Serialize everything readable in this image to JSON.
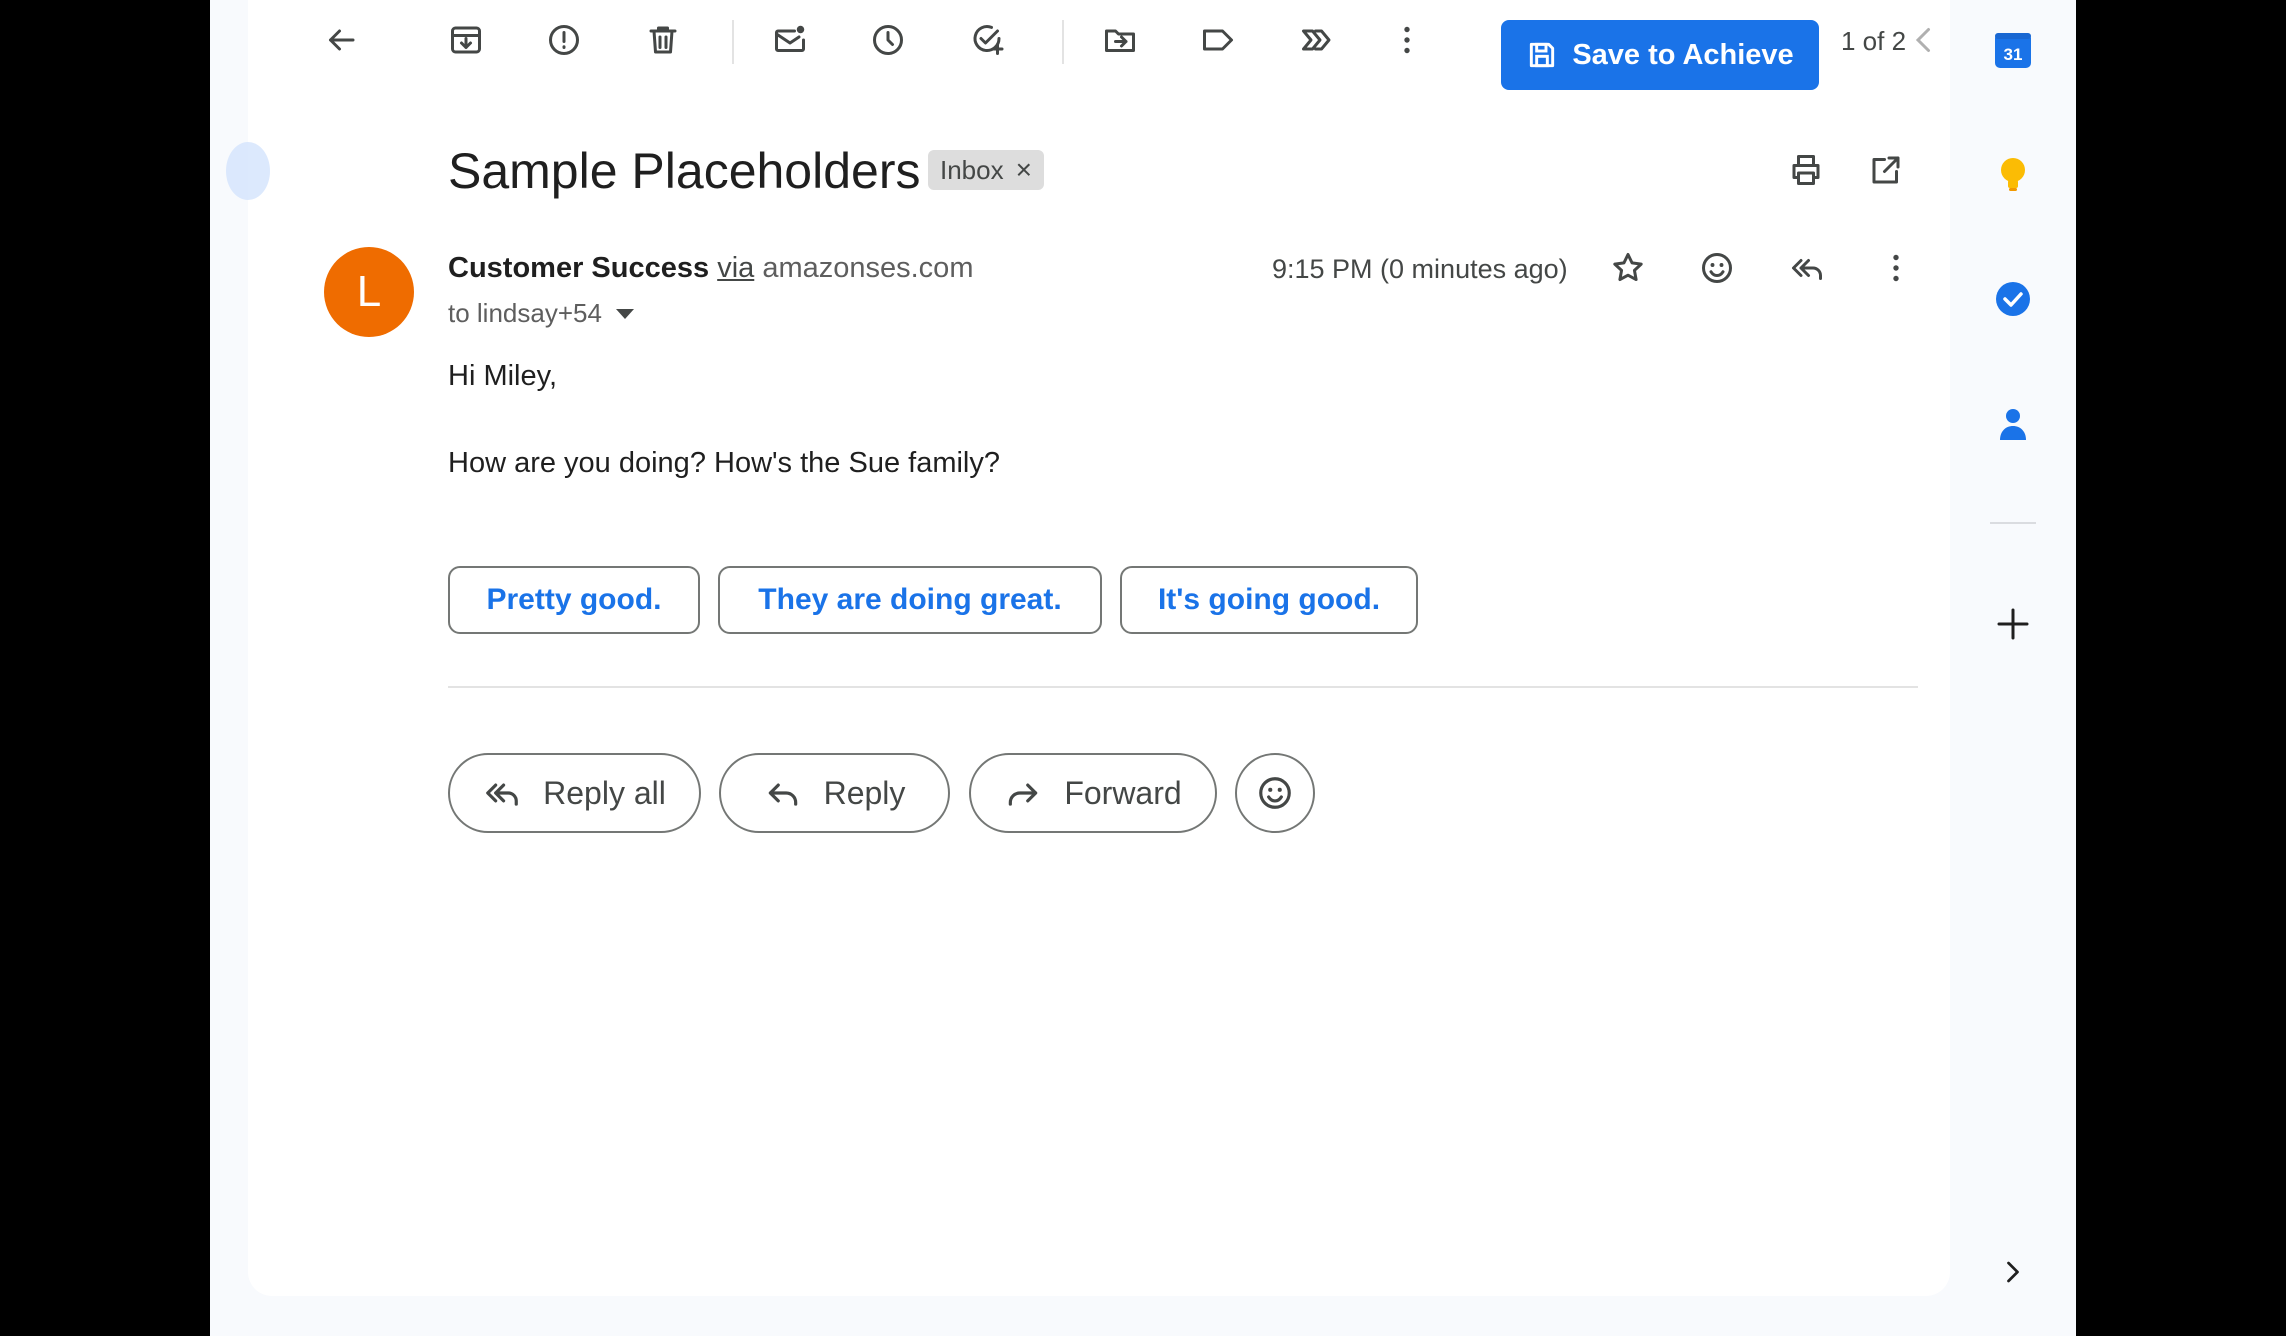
{
  "toolbar": {
    "icons": [
      "arrow-left-icon",
      "archive-icon",
      "report-spam-icon",
      "trash-icon",
      "mark-unread-icon",
      "snooze-icon",
      "add-task-icon",
      "move-to-icon",
      "label-icon",
      "filter-icon",
      "more-vert-icon"
    ],
    "save_button_label": "Save to Achieve",
    "pager": "1 of 2"
  },
  "email": {
    "subject": "Sample Placeholders",
    "label_chip": "Inbox",
    "label_remove": "×",
    "avatar_letter": "L",
    "avatar_color": "#ef6c00",
    "sender_name": "Customer Success",
    "via_text": "via",
    "sender_domain": "amazonses.com",
    "to_text": "to lindsay+54",
    "timestamp": "9:15 PM (0 minutes ago)",
    "body": {
      "greeting": "Hi Miley,",
      "line1": "How are you doing? How's the Sue family?"
    },
    "smart_replies": [
      "Pretty good.",
      "They are doing great.",
      "It's going good."
    ],
    "actions": {
      "reply_all": "Reply all",
      "reply": "Reply",
      "forward": "Forward"
    }
  },
  "side_panel": {
    "calendar_day": "31",
    "icons": [
      "calendar-icon",
      "keep-icon",
      "tasks-icon",
      "contacts-icon",
      "add-icon",
      "expand-icon"
    ]
  },
  "colors": {
    "accent": "#1a73e8",
    "avatar": "#ef6c00",
    "keep": "#fbbc04"
  }
}
